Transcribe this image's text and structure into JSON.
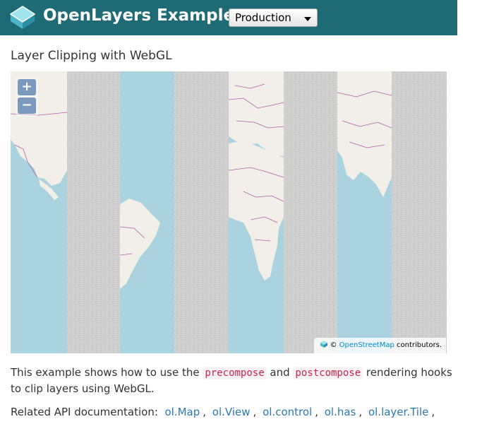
{
  "header": {
    "brand": "OpenLayers Examples",
    "mode_select": {
      "selected": "Production"
    }
  },
  "page": {
    "title": "Layer Clipping with WebGL"
  },
  "map": {
    "zoom_in_label": "+",
    "zoom_out_label": "−",
    "attribution": {
      "prefix": "© ",
      "link_text": "OpenStreetMap",
      "suffix": " contributors."
    },
    "colors": {
      "water": "#aad3df",
      "land": "#f2efe9",
      "stripe": "#d0d0d0",
      "borders": "#b05fa4"
    }
  },
  "description": {
    "text_1": "This example shows how to use the ",
    "code_1": "precompose",
    "text_2": " and ",
    "code_2": "postcompose",
    "text_3": " rendering hooks to clip layers using WebGL."
  },
  "related": {
    "label": "Related API documentation:",
    "links": [
      "ol.Map",
      "ol.View",
      "ol.control",
      "ol.has",
      "ol.layer.Tile"
    ]
  }
}
